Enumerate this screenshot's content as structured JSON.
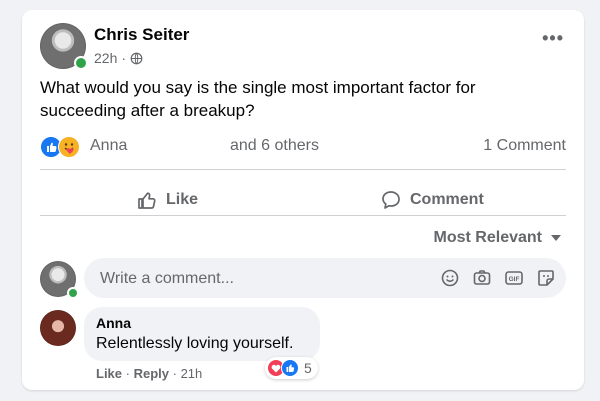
{
  "post": {
    "author": "Chris Seiter",
    "time": "22h",
    "separator": "·",
    "text": "What would you say is the single most important factor for succeeding after a breakup?"
  },
  "reactions": {
    "icons": [
      "like-icon",
      "care-icon"
    ],
    "first_name": "Anna",
    "others": "and 6 others",
    "comment_count": "1 Comment"
  },
  "actions": {
    "like": "Like",
    "comment": "Comment"
  },
  "sort": {
    "label": "Most Relevant"
  },
  "composer": {
    "placeholder": "Write a comment...",
    "icons": [
      "emoji-icon",
      "camera-icon",
      "gif-icon",
      "sticker-icon"
    ]
  },
  "comment": {
    "author": "Anna",
    "text": "Relentlessly loving yourself.",
    "reaction_count": "5",
    "like": "Like",
    "reply": "Reply",
    "time": "21h"
  },
  "colors": {
    "like_blue": "#1877f2",
    "love_red": "#f33e58",
    "online_green": "#31a24c",
    "muted_text": "#65676b"
  }
}
